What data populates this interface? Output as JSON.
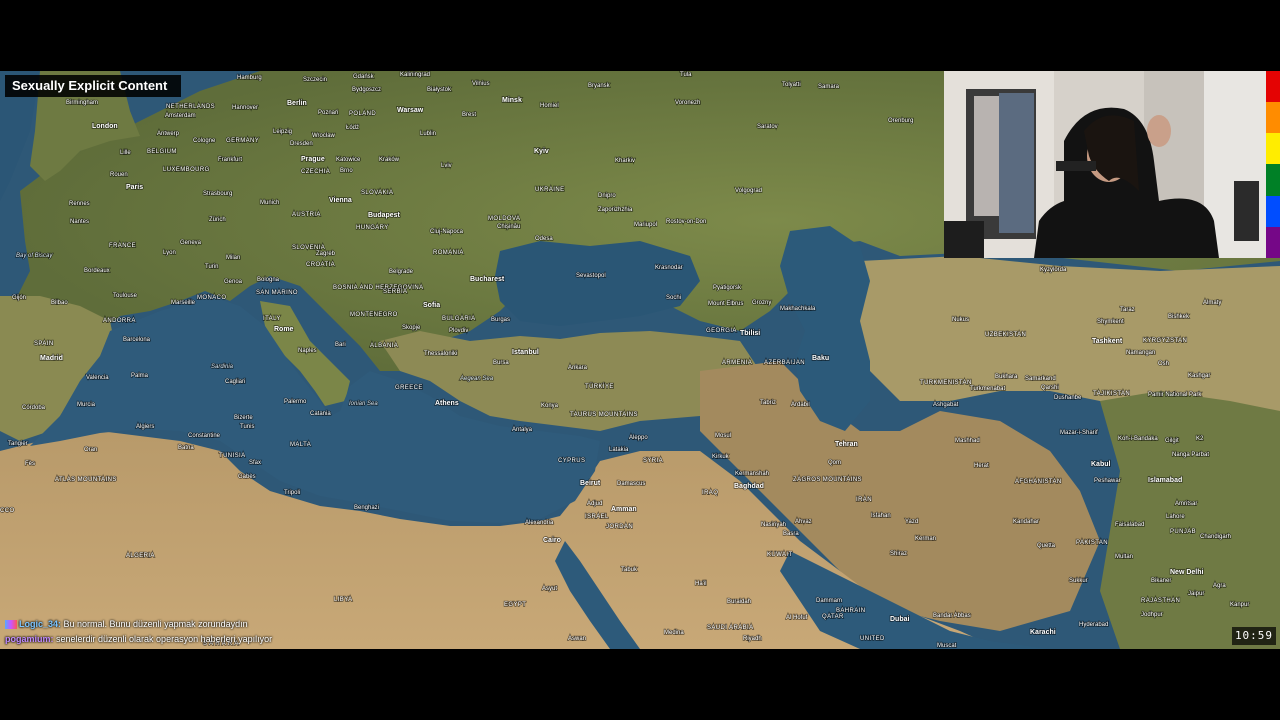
{
  "overlay": {
    "warning_label": "Sexually Explicit Content",
    "clock": "10:59"
  },
  "chat": [
    {
      "user": "Logic_34:",
      "message": " Bu normal. Bunu düzenli yapmak zorundaydın"
    },
    {
      "user": "pogamium:",
      "message": " senelerdir düzenli olarak operasyon haberleri yapılıyor"
    }
  ],
  "map": {
    "labels": [
      {
        "name": "London",
        "kind": "cap"
      },
      {
        "name": "Paris",
        "kind": "cap"
      },
      {
        "name": "Berlin",
        "kind": "cap"
      },
      {
        "name": "Hamburg",
        "kind": "city"
      },
      {
        "name": "Szczecin",
        "kind": "city"
      },
      {
        "name": "Gdańsk",
        "kind": "city"
      },
      {
        "name": "Kaliningrad",
        "kind": "city"
      },
      {
        "name": "Vilnius",
        "kind": "city"
      },
      {
        "name": "Minsk",
        "kind": "cap"
      },
      {
        "name": "Bryansk",
        "kind": "city"
      },
      {
        "name": "Tula",
        "kind": "city"
      },
      {
        "name": "Tolyatti",
        "kind": "city"
      },
      {
        "name": "Samara",
        "kind": "city"
      },
      {
        "name": "Birmingham",
        "kind": "city"
      },
      {
        "name": "Hannover",
        "kind": "city"
      },
      {
        "name": "Bydgoszcz",
        "kind": "city"
      },
      {
        "name": "Białystok",
        "kind": "city"
      },
      {
        "name": "Homiel",
        "kind": "city"
      },
      {
        "name": "Voronezh",
        "kind": "city"
      },
      {
        "name": "Saratov",
        "kind": "city"
      },
      {
        "name": "Orenburg",
        "kind": "city"
      },
      {
        "name": "Amsterdam",
        "kind": "city"
      },
      {
        "name": "Poznań",
        "kind": "city"
      },
      {
        "name": "Warsaw",
        "kind": "cap"
      },
      {
        "name": "Brest",
        "kind": "city"
      },
      {
        "name": "Antwerp",
        "kind": "city"
      },
      {
        "name": "Leipzig",
        "kind": "city"
      },
      {
        "name": "Wrocław",
        "kind": "city"
      },
      {
        "name": "Łódź",
        "kind": "city"
      },
      {
        "name": "Lublin",
        "kind": "city"
      },
      {
        "name": "BELGIUM",
        "kind": "country"
      },
      {
        "name": "Cologne",
        "kind": "city"
      },
      {
        "name": "GERMANY",
        "kind": "country"
      },
      {
        "name": "POLAND",
        "kind": "country"
      },
      {
        "name": "Kyiv",
        "kind": "cap"
      },
      {
        "name": "Kharkiv",
        "kind": "city"
      },
      {
        "name": "Lille",
        "kind": "city"
      },
      {
        "name": "Dresden",
        "kind": "city"
      },
      {
        "name": "LUXEMBOURG",
        "kind": "country"
      },
      {
        "name": "Frankfurt",
        "kind": "city"
      },
      {
        "name": "Prague",
        "kind": "cap"
      },
      {
        "name": "Katowice",
        "kind": "city"
      },
      {
        "name": "Kraków",
        "kind": "city"
      },
      {
        "name": "Lviv",
        "kind": "city"
      },
      {
        "name": "Rouen",
        "kind": "city"
      },
      {
        "name": "CZECHIA",
        "kind": "country"
      },
      {
        "name": "Brno",
        "kind": "city"
      },
      {
        "name": "UKRAINE",
        "kind": "country"
      },
      {
        "name": "Volgograd",
        "kind": "city"
      },
      {
        "name": "Strasbourg",
        "kind": "city"
      },
      {
        "name": "Vienna",
        "kind": "cap"
      },
      {
        "name": "SLOVAKIA",
        "kind": "country"
      },
      {
        "name": "Dnipro",
        "kind": "city"
      },
      {
        "name": "Rennes",
        "kind": "city"
      },
      {
        "name": "Munich",
        "kind": "city"
      },
      {
        "name": "Zaporizhzhia",
        "kind": "city"
      },
      {
        "name": "Nantes",
        "kind": "city"
      },
      {
        "name": "Zürich",
        "kind": "city"
      },
      {
        "name": "AUSTRIA",
        "kind": "country"
      },
      {
        "name": "Budapest",
        "kind": "cap"
      },
      {
        "name": "MOLDOVA",
        "kind": "country"
      },
      {
        "name": "Rostov-on-Don",
        "kind": "city"
      },
      {
        "name": "Chișinău",
        "kind": "city"
      },
      {
        "name": "HUNGARY",
        "kind": "country"
      },
      {
        "name": "Mariupol",
        "kind": "city"
      },
      {
        "name": "Cluj-Napoca",
        "kind": "city"
      },
      {
        "name": "Odesa",
        "kind": "city"
      },
      {
        "name": "Geneva",
        "kind": "city"
      },
      {
        "name": "Milan",
        "kind": "city"
      },
      {
        "name": "SLOVENIA",
        "kind": "country"
      },
      {
        "name": "Bay of Biscay",
        "kind": "sea"
      },
      {
        "name": "FRANCE",
        "kind": "country"
      },
      {
        "name": "Lyon",
        "kind": "city"
      },
      {
        "name": "Turin",
        "kind": "city"
      },
      {
        "name": "Zagreb",
        "kind": "city"
      },
      {
        "name": "CROATIA",
        "kind": "country"
      },
      {
        "name": "ROMANIA",
        "kind": "country"
      },
      {
        "name": "Krasnodar",
        "kind": "city"
      },
      {
        "name": "Bordeaux",
        "kind": "city"
      },
      {
        "name": "Bologna",
        "kind": "city"
      },
      {
        "name": "Belgrade",
        "kind": "city"
      },
      {
        "name": "Sevastopol",
        "kind": "city"
      },
      {
        "name": "Pyatigorsk",
        "kind": "city"
      },
      {
        "name": "Makhachkala",
        "kind": "city"
      },
      {
        "name": "Marseille",
        "kind": "city"
      },
      {
        "name": "Genoa",
        "kind": "city"
      },
      {
        "name": "SAN MARINO",
        "kind": "country"
      },
      {
        "name": "BOSNIA AND HERZEGOVINA",
        "kind": "country"
      },
      {
        "name": "SERBIA",
        "kind": "country"
      },
      {
        "name": "Bucharest",
        "kind": "cap"
      },
      {
        "name": "Sochi",
        "kind": "city"
      },
      {
        "name": "Mount Elbrus",
        "kind": "city"
      },
      {
        "name": "Grozny",
        "kind": "city"
      },
      {
        "name": "Gijón",
        "kind": "city"
      },
      {
        "name": "Bilbao",
        "kind": "city"
      },
      {
        "name": "Toulouse",
        "kind": "city"
      },
      {
        "name": "ANDORRA",
        "kind": "country"
      },
      {
        "name": "MONACO",
        "kind": "country"
      },
      {
        "name": "Sofia",
        "kind": "cap"
      },
      {
        "name": "BULGARIA",
        "kind": "country"
      },
      {
        "name": "Burgas",
        "kind": "city"
      },
      {
        "name": "GEORGIA",
        "kind": "country"
      },
      {
        "name": "Tbilisi",
        "kind": "cap"
      },
      {
        "name": "SPAIN",
        "kind": "country"
      },
      {
        "name": "ITALY",
        "kind": "country"
      },
      {
        "name": "Rome",
        "kind": "cap"
      },
      {
        "name": "MONTENEGRO",
        "kind": "country"
      },
      {
        "name": "Skopje",
        "kind": "city"
      },
      {
        "name": "Plovdiv",
        "kind": "city"
      },
      {
        "name": "Barcelona",
        "kind": "city"
      },
      {
        "name": "Bari",
        "kind": "city"
      },
      {
        "name": "ALBANIA",
        "kind": "country"
      },
      {
        "name": "Madrid",
        "kind": "cap"
      },
      {
        "name": "Naples",
        "kind": "city"
      },
      {
        "name": "Thessaloniki",
        "kind": "city"
      },
      {
        "name": "Istanbul",
        "kind": "cap"
      },
      {
        "name": "ARMENIA",
        "kind": "country"
      },
      {
        "name": "AZERBAIJAN",
        "kind": "country"
      },
      {
        "name": "Baku",
        "kind": "cap"
      },
      {
        "name": "Sardinia",
        "kind": "sea"
      },
      {
        "name": "Bursa",
        "kind": "city"
      },
      {
        "name": "Ankara",
        "kind": "city"
      },
      {
        "name": "Valencia",
        "kind": "city"
      },
      {
        "name": "Palma",
        "kind": "city"
      },
      {
        "name": "Cagliari",
        "kind": "city"
      },
      {
        "name": "GREECE",
        "kind": "country"
      },
      {
        "name": "Aegean Sea",
        "kind": "sea"
      },
      {
        "name": "TÜRKİYE",
        "kind": "country"
      },
      {
        "name": "Córdoba",
        "kind": "city"
      },
      {
        "name": "Murcia",
        "kind": "city"
      },
      {
        "name": "Ionian Sea",
        "kind": "sea"
      },
      {
        "name": "Athens",
        "kind": "cap"
      },
      {
        "name": "Konya",
        "kind": "city"
      },
      {
        "name": "TAURUS MOUNTAINS",
        "kind": "country"
      },
      {
        "name": "Tabriz",
        "kind": "city"
      },
      {
        "name": "Ardabil",
        "kind": "city"
      },
      {
        "name": "Palermo",
        "kind": "city"
      },
      {
        "name": "Catania",
        "kind": "city"
      },
      {
        "name": "Algiers",
        "kind": "city"
      },
      {
        "name": "Bizerte",
        "kind": "city"
      },
      {
        "name": "Tunis",
        "kind": "city"
      },
      {
        "name": "Antalya",
        "kind": "city"
      },
      {
        "name": "Aleppo",
        "kind": "city"
      },
      {
        "name": "Mosul",
        "kind": "city"
      },
      {
        "name": "Tangier",
        "kind": "city"
      },
      {
        "name": "Constantine",
        "kind": "city"
      },
      {
        "name": "MALTA",
        "kind": "country"
      },
      {
        "name": "Latakia",
        "kind": "city"
      },
      {
        "name": "SYRIA",
        "kind": "country"
      },
      {
        "name": "Kirkuk",
        "kind": "city"
      },
      {
        "name": "Tehran",
        "kind": "cap"
      },
      {
        "name": "Fès",
        "kind": "city"
      },
      {
        "name": "Oran",
        "kind": "city"
      },
      {
        "name": "Batna",
        "kind": "city"
      },
      {
        "name": "TUNISIA",
        "kind": "country"
      },
      {
        "name": "Sfax",
        "kind": "city"
      },
      {
        "name": "CYPRUS",
        "kind": "country"
      },
      {
        "name": "Beirut",
        "kind": "cap"
      },
      {
        "name": "Damascus",
        "kind": "city"
      },
      {
        "name": "Baghdad",
        "kind": "cap"
      },
      {
        "name": "Kermanshah",
        "kind": "city"
      },
      {
        "name": "Qom",
        "kind": "city"
      },
      {
        "name": "ATLAS MOUNTAINS",
        "kind": "country"
      },
      {
        "name": "Gabès",
        "kind": "city"
      },
      {
        "name": "Tripoli",
        "kind": "city"
      },
      {
        "name": "Adjud",
        "kind": "city"
      },
      {
        "name": "Amman",
        "kind": "cap"
      },
      {
        "name": "IRAQ",
        "kind": "country"
      },
      {
        "name": "ZAGROS MOUNTAINS",
        "kind": "country"
      },
      {
        "name": "IRAN",
        "kind": "country"
      },
      {
        "name": "CCO",
        "kind": "country"
      },
      {
        "name": "Benghazi",
        "kind": "city"
      },
      {
        "name": "Alexandria",
        "kind": "city"
      },
      {
        "name": "ISRAEL",
        "kind": "country"
      },
      {
        "name": "JORDAN",
        "kind": "country"
      },
      {
        "name": "Nasiriyah",
        "kind": "city"
      },
      {
        "name": "Ahvaz",
        "kind": "city"
      },
      {
        "name": "Isfahan",
        "kind": "city"
      },
      {
        "name": "Cairo",
        "kind": "cap"
      },
      {
        "name": "Basra",
        "kind": "city"
      },
      {
        "name": "KUWAIT",
        "kind": "country"
      },
      {
        "name": "Shiraz",
        "kind": "city"
      },
      {
        "name": "ALGERIA",
        "kind": "country"
      },
      {
        "name": "LIBYA",
        "kind": "country"
      },
      {
        "name": "Tabuk",
        "kind": "city"
      },
      {
        "name": "Ha'il",
        "kind": "city"
      },
      {
        "name": "EGYPT",
        "kind": "country"
      },
      {
        "name": "Asyut",
        "kind": "city"
      },
      {
        "name": "Buraidah",
        "kind": "city"
      },
      {
        "name": "Dammam",
        "kind": "city"
      },
      {
        "name": "Al Hofuf",
        "kind": "city"
      },
      {
        "name": "BAHRAIN",
        "kind": "country"
      },
      {
        "name": "QATAR",
        "kind": "country"
      },
      {
        "name": "Dubai",
        "kind": "cap"
      },
      {
        "name": "UNITED",
        "kind": "country"
      },
      {
        "name": "Aswan",
        "kind": "city"
      },
      {
        "name": "Medina",
        "kind": "city"
      },
      {
        "name": "SAUDI ARABIA",
        "kind": "country"
      },
      {
        "name": "Riyadh",
        "kind": "city"
      },
      {
        "name": "Muscat",
        "kind": "city"
      },
      {
        "name": "S A H A R A",
        "kind": "country"
      },
      {
        "name": "Kyzylorda",
        "kind": "city"
      },
      {
        "name": "Almaty",
        "kind": "city"
      },
      {
        "name": "Taraz",
        "kind": "city"
      },
      {
        "name": "Bishkek",
        "kind": "city"
      },
      {
        "name": "Nukus",
        "kind": "city"
      },
      {
        "name": "Shymkent",
        "kind": "city"
      },
      {
        "name": "UZBEKISTAN",
        "kind": "country"
      },
      {
        "name": "Tashkent",
        "kind": "cap"
      },
      {
        "name": "KYRGYZSTAN",
        "kind": "country"
      },
      {
        "name": "Namangan",
        "kind": "city"
      },
      {
        "name": "Osh",
        "kind": "city"
      },
      {
        "name": "TURKMENISTAN",
        "kind": "country"
      },
      {
        "name": "Turkmenabat",
        "kind": "city"
      },
      {
        "name": "Bukhara",
        "kind": "city"
      },
      {
        "name": "Samarkand",
        "kind": "city"
      },
      {
        "name": "Kashgar",
        "kind": "city"
      },
      {
        "name": "Qarshi",
        "kind": "city"
      },
      {
        "name": "Dushanbe",
        "kind": "city"
      },
      {
        "name": "TAJIKISTAN",
        "kind": "country"
      },
      {
        "name": "Pamir National Park",
        "kind": "city"
      },
      {
        "name": "Ashgabat",
        "kind": "city"
      },
      {
        "name": "Mazar-i-Sharif",
        "kind": "city"
      },
      {
        "name": "Kabul",
        "kind": "cap"
      },
      {
        "name": "Mashhad",
        "kind": "city"
      },
      {
        "name": "Koh-i-Bandaka",
        "kind": "city"
      },
      {
        "name": "Gilgit",
        "kind": "city"
      },
      {
        "name": "Nanga Parbat",
        "kind": "city"
      },
      {
        "name": "K2",
        "kind": "city"
      },
      {
        "name": "AFGHANISTAN",
        "kind": "country"
      },
      {
        "name": "Peshawar",
        "kind": "city"
      },
      {
        "name": "Islamabad",
        "kind": "cap"
      },
      {
        "name": "Herat",
        "kind": "city"
      },
      {
        "name": "Kandahar",
        "kind": "city"
      },
      {
        "name": "Faisalabad",
        "kind": "city"
      },
      {
        "name": "Lahore",
        "kind": "city"
      },
      {
        "name": "Amritsar",
        "kind": "city"
      },
      {
        "name": "Quetta",
        "kind": "city"
      },
      {
        "name": "PAKISTAN",
        "kind": "country"
      },
      {
        "name": "PUNJAB",
        "kind": "country"
      },
      {
        "name": "Chandigarh",
        "kind": "city"
      },
      {
        "name": "Kerman",
        "kind": "city"
      },
      {
        "name": "Multan",
        "kind": "city"
      },
      {
        "name": "New Delhi",
        "kind": "cap"
      },
      {
        "name": "Sukkur",
        "kind": "city"
      },
      {
        "name": "Bikaner",
        "kind": "city"
      },
      {
        "name": "Jaipur",
        "kind": "city"
      },
      {
        "name": "Karachi",
        "kind": "cap"
      },
      {
        "name": "RAJASTHAN",
        "kind": "country"
      },
      {
        "name": "Kanpur",
        "kind": "city"
      },
      {
        "name": "Hyderabad",
        "kind": "city"
      },
      {
        "name": "Agra",
        "kind": "city"
      },
      {
        "name": "Jodhpur",
        "kind": "city"
      },
      {
        "name": "UNITED KINGDOM",
        "kind": "country"
      },
      {
        "name": "NETHERLANDS",
        "kind": "country"
      },
      {
        "name": "Bandar Abbas",
        "kind": "city"
      },
      {
        "name": "Yazd",
        "kind": "city"
      }
    ]
  }
}
